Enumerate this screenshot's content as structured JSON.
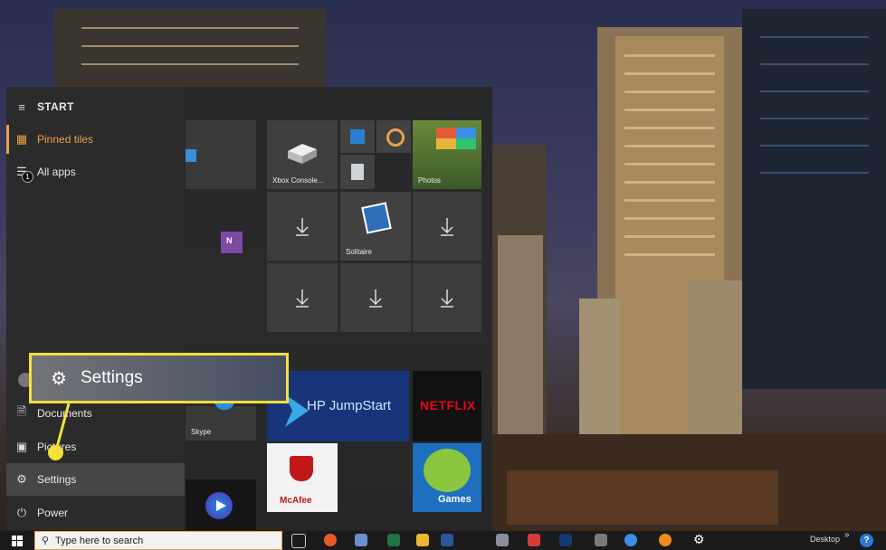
{
  "start_menu": {
    "title": "START",
    "nav": {
      "pinned_tiles": "Pinned tiles",
      "all_apps": "All apps",
      "all_apps_badge": "1",
      "documents": "Documents",
      "pictures": "Pictures",
      "settings": "Settings",
      "power": "Power"
    },
    "tiles": {
      "xbox": "Xbox Console...",
      "photos": "Photos",
      "solitaire": "Solitaire",
      "skype": "Skype",
      "hp_jumpstart": "HP JumpStart",
      "netflix": "NETFLIX",
      "mcafee": "McAfee",
      "games": "Games"
    }
  },
  "callout": {
    "label": "Settings"
  },
  "taskbar": {
    "search_placeholder": "Type here to search",
    "desktop_label": "Desktop",
    "chevron": "»",
    "help_glyph": "?"
  },
  "accent_color": "#e9a24b",
  "highlight_color": "#f2e13a"
}
